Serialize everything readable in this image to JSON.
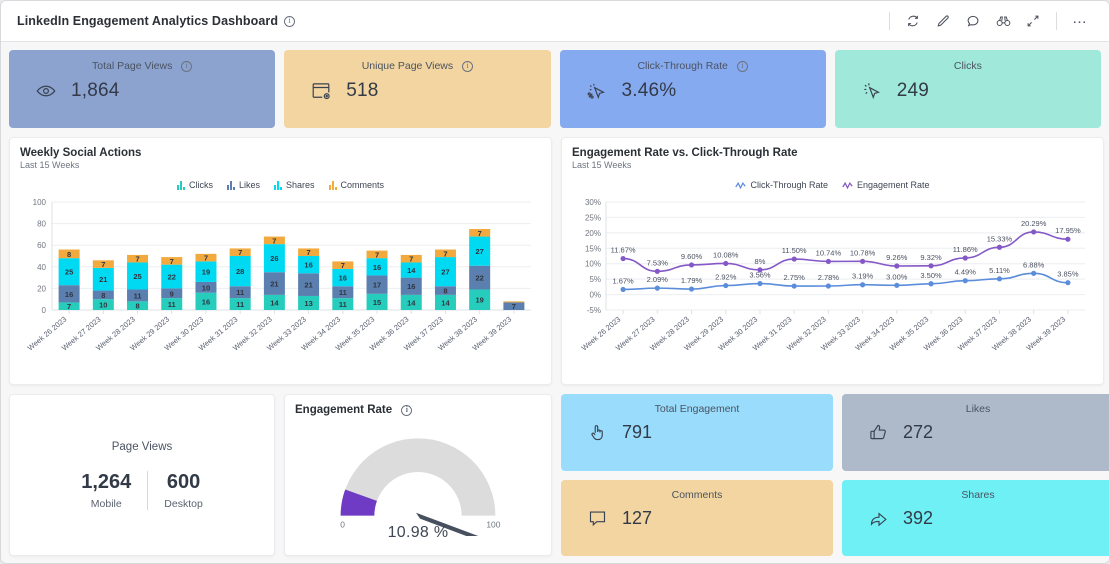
{
  "header": {
    "title": "LinkedIn Engagement Analytics Dashboard",
    "info_icon": "info-icon",
    "toolbar": [
      {
        "name": "refresh-icon",
        "label": "Refresh"
      },
      {
        "name": "edit-pencil-icon",
        "label": "Edit"
      },
      {
        "name": "comment-icon",
        "label": "Comment"
      },
      {
        "name": "binoculars-icon",
        "label": "Explore"
      },
      {
        "name": "expand-icon",
        "label": "Full screen"
      },
      {
        "name": "more-options-icon",
        "label": "…"
      }
    ]
  },
  "kpis": [
    {
      "label": "Total Page Views",
      "value": "1,864",
      "icon": "eye-icon",
      "has_info": true,
      "bg": "#8ca3d0"
    },
    {
      "label": "Unique Page Views",
      "value": "518",
      "icon": "page-view-icon",
      "has_info": true,
      "bg": "#f2d5a0"
    },
    {
      "label": "Click-Through Rate",
      "value": "3.46%",
      "icon": "cursor-percent-icon",
      "has_info": true,
      "bg": "#86aaef"
    },
    {
      "label": "Clicks",
      "value": "249",
      "icon": "cursor-click-icon",
      "has_info": false,
      "bg": "#9fe8da"
    }
  ],
  "bar_chart": {
    "title": "Weekly Social Actions",
    "subtitle": "Last 15 Weeks"
  },
  "line_chart": {
    "title": "Engagement Rate vs. Click-Through Rate",
    "subtitle": "Last 15 Weeks"
  },
  "page_views": {
    "title": "Page Views",
    "mobile_value": "1,264",
    "mobile_label": "Mobile",
    "desktop_value": "600",
    "desktop_label": "Desktop"
  },
  "gauge": {
    "title": "Engagement Rate",
    "has_info": true,
    "value_text": "10.98 %",
    "value": 10.98,
    "min_label": "0",
    "max_label": "100",
    "arc_color": "#6f3bc4",
    "track_color": "#dcdcdd",
    "needle_color": "#46505e"
  },
  "mini_kpis": [
    {
      "label": "Total Engagement",
      "value": "791",
      "icon": "pointing-hand-icon",
      "bg": "#9adcfb"
    },
    {
      "label": "Likes",
      "value": "272",
      "icon": "thumbs-up-icon",
      "bg": "#aeb9c9"
    },
    {
      "label": "Comments",
      "value": "127",
      "icon": "speech-bubble-icon",
      "bg": "#f2d5a0"
    },
    {
      "label": "Shares",
      "value": "392",
      "icon": "share-arrow-icon",
      "bg": "#6ef0f5"
    }
  ],
  "chart_data": [
    {
      "type": "bar",
      "stacked": true,
      "title": "Weekly Social Actions",
      "subtitle": "Last 15 Weeks",
      "xlabel": "",
      "ylabel": "",
      "ylim": [
        0,
        100
      ],
      "yticks": [
        0,
        20,
        40,
        60,
        80,
        100
      ],
      "grid": true,
      "legend_position": "top-center",
      "categories": [
        "Week 26 2023",
        "Week 27 2023",
        "Week 28 2023",
        "Week 29 2023",
        "Week 30 2023",
        "Week 31 2023",
        "Week 32 2023",
        "Week 33 2023",
        "Week 34 2023",
        "Week 35 2023",
        "Week 36 2023",
        "Week 37 2023",
        "Week 38 2023",
        "Week 39 2023"
      ],
      "series": [
        {
          "name": "Clicks",
          "color": "#26cdbd",
          "values": [
            7,
            10,
            8,
            11,
            16,
            11,
            14,
            13,
            11,
            15,
            14,
            14,
            19,
            0
          ]
        },
        {
          "name": "Likes",
          "color": "#5b7fae",
          "values": [
            16,
            8,
            11,
            9,
            10,
            11,
            21,
            21,
            11,
            17,
            16,
            8,
            22,
            7
          ]
        },
        {
          "name": "Shares",
          "color": "#00d9f2",
          "values": [
            25,
            21,
            25,
            22,
            19,
            28,
            26,
            16,
            16,
            16,
            14,
            27,
            27,
            0
          ]
        },
        {
          "name": "Comments",
          "color": "#f2a93e",
          "values": [
            8,
            7,
            7,
            7,
            7,
            7,
            7,
            7,
            7,
            7,
            7,
            7,
            7,
            1
          ]
        }
      ]
    },
    {
      "type": "line",
      "title": "Engagement Rate vs. Click-Through Rate",
      "subtitle": "Last 15 Weeks",
      "xlabel": "",
      "ylabel": "",
      "ylim": [
        -5,
        30
      ],
      "yticks": [
        -5,
        0,
        5,
        10,
        15,
        20,
        25,
        30
      ],
      "ytick_labels": [
        "-5%",
        "0%",
        "5%",
        "10%",
        "15%",
        "20%",
        "25%",
        "30%"
      ],
      "grid": true,
      "legend_position": "top-center",
      "categories": [
        "Week 26 2023",
        "Week 27 2023",
        "Week 28 2023",
        "Week 29 2023",
        "Week 30 2023",
        "Week 31 2023",
        "Week 32 2023",
        "Week 33 2023",
        "Week 34 2023",
        "Week 35 2023",
        "Week 36 2023",
        "Week 37 2023",
        "Week 38 2023",
        "Week 39 2023"
      ],
      "series": [
        {
          "name": "Click-Through Rate",
          "color": "#5b8ddb",
          "values": [
            1.67,
            2.09,
            1.79,
            2.92,
            3.56,
            2.75,
            2.78,
            3.19,
            3.0,
            3.5,
            4.49,
            5.11,
            6.88,
            3.85
          ],
          "labels": [
            "1.67%",
            "2.09%",
            "1.79%",
            "2.92%",
            "3.56%",
            "2.75%",
            "2.78%",
            "3.19%",
            "3.00%",
            "3.50%",
            "4.49%",
            "5.11%",
            "6.88%",
            "3.85%"
          ]
        },
        {
          "name": "Engagement Rate",
          "color": "#8458c6",
          "values": [
            11.67,
            7.53,
            9.6,
            10.08,
            8.0,
            11.5,
            10.74,
            10.78,
            9.26,
            9.32,
            11.86,
            15.33,
            20.29,
            17.95
          ],
          "labels": [
            "11.67%",
            "7.53%",
            "9.60%",
            "10.08%",
            "8%",
            "11.50%",
            "10.74%",
            "10.78%",
            "9.26%",
            "9.32%",
            "11.86%",
            "15.33%",
            "20.29%",
            "17.95%"
          ]
        }
      ]
    },
    {
      "type": "gauge",
      "title": "Engagement Rate",
      "value": 10.98,
      "value_label": "10.98 %",
      "min": 0,
      "max": 100,
      "arc_color": "#6f3bc4",
      "track_color": "#dcdcdd"
    }
  ]
}
